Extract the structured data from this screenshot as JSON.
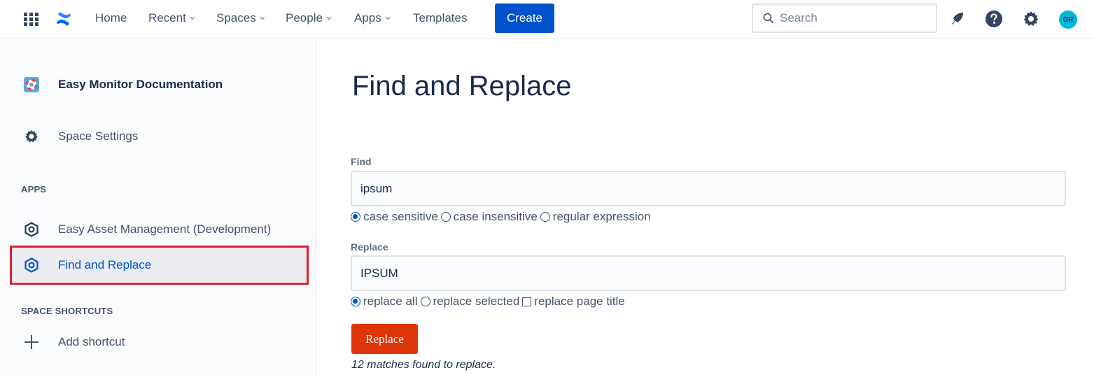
{
  "topnav": {
    "links": [
      {
        "label": "Home",
        "dropdown": false
      },
      {
        "label": "Recent",
        "dropdown": true
      },
      {
        "label": "Spaces",
        "dropdown": true
      },
      {
        "label": "People",
        "dropdown": true
      },
      {
        "label": "Apps",
        "dropdown": true
      },
      {
        "label": "Templates",
        "dropdown": false
      }
    ],
    "create_label": "Create",
    "search_placeholder": "Search",
    "avatar_initials": "OR",
    "icons": [
      "app-switcher-icon",
      "confluence-logo-icon",
      "notifications-icon",
      "help-icon",
      "settings-icon"
    ]
  },
  "sidebar": {
    "space_name": "Easy Monitor Documentation",
    "space_settings": "Space Settings",
    "apps_heading": "APPS",
    "apps": [
      {
        "label": "Easy Asset Management (Development)",
        "active": false
      },
      {
        "label": "Find and Replace",
        "active": true
      }
    ],
    "shortcuts_heading": "SPACE SHORTCUTS",
    "add_shortcut": "Add shortcut"
  },
  "main": {
    "title": "Find and Replace",
    "find_label": "Find",
    "find_value": "ipsum",
    "find_options": [
      {
        "label": "case sensitive",
        "checked": true
      },
      {
        "label": "case insensitive",
        "checked": false
      },
      {
        "label": "regular expression",
        "checked": false
      }
    ],
    "replace_label": "Replace",
    "replace_value": "IPSUM",
    "replace_options": [
      {
        "label": "replace all",
        "type": "radio",
        "checked": true
      },
      {
        "label": "replace selected",
        "type": "radio",
        "checked": false
      },
      {
        "label": "replace page title",
        "type": "checkbox",
        "checked": false
      }
    ],
    "replace_button": "Replace",
    "result": "12 matches found to replace."
  },
  "colors": {
    "primary": "#0052cc",
    "replace_button": "#de350b",
    "highlight_border": "#e01e2b",
    "avatar": "#00b8d9"
  }
}
